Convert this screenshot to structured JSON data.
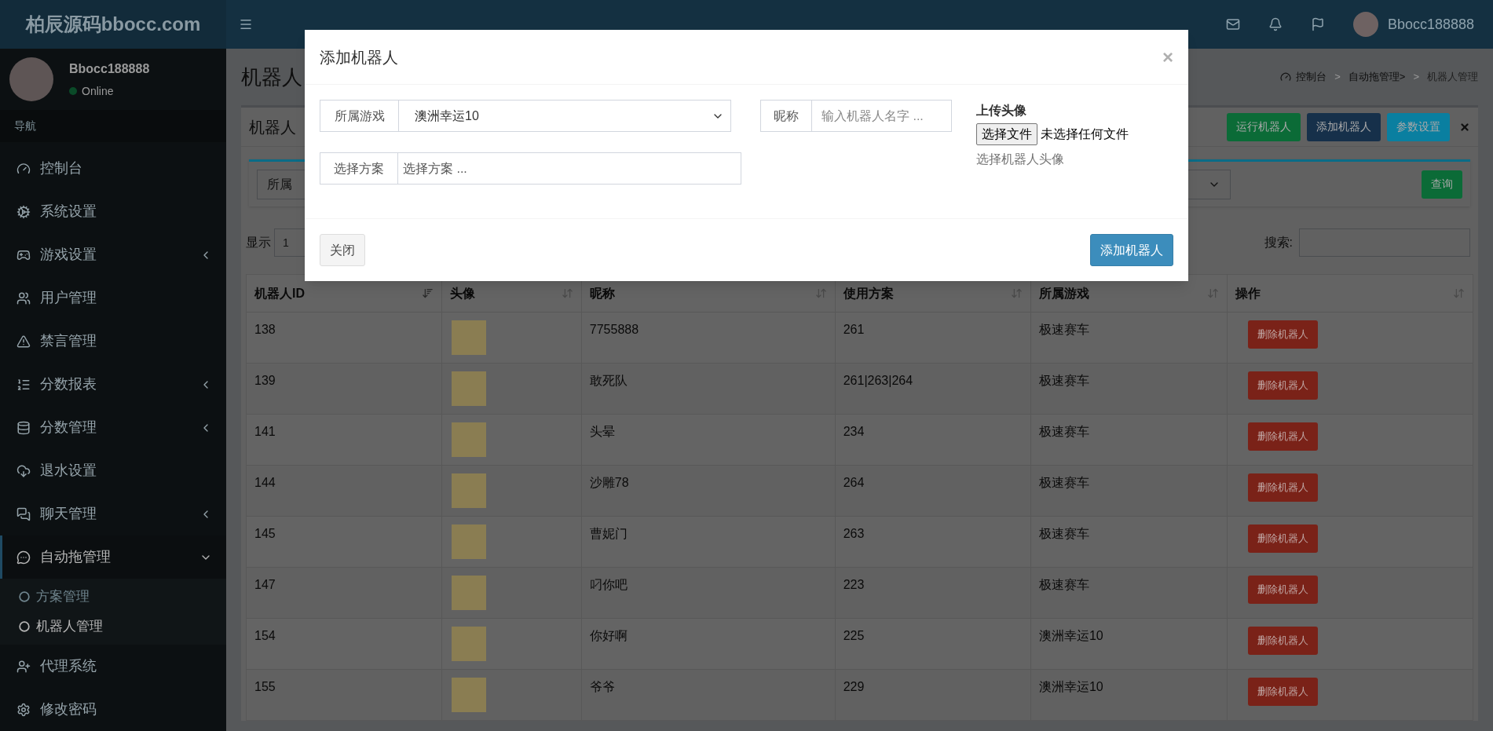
{
  "header": {
    "logo": "柏辰源码bbocc.com",
    "user_name": "Bbocc188888"
  },
  "sidebar": {
    "user": {
      "name": "Bbocc188888",
      "status": "Online"
    },
    "nav_header": "导航",
    "items": [
      {
        "label": "控制台",
        "selected": false
      },
      {
        "label": "系统设置",
        "selected": false
      },
      {
        "label": "游戏设置",
        "selected": false,
        "expanded": false
      },
      {
        "label": "用户管理",
        "selected": false
      },
      {
        "label": "禁言管理",
        "selected": false
      },
      {
        "label": "分数报表",
        "selected": false,
        "expanded": false
      },
      {
        "label": "分数管理",
        "selected": false,
        "expanded": false
      },
      {
        "label": "退水设置",
        "selected": false
      },
      {
        "label": "聊天管理",
        "selected": false,
        "expanded": false
      },
      {
        "label": "自动拖管理",
        "selected": true,
        "expanded": true,
        "children": [
          {
            "label": "方案管理",
            "selected": false
          },
          {
            "label": "机器人管理",
            "selected": true
          }
        ]
      },
      {
        "label": "代理系统",
        "selected": false
      },
      {
        "label": "修改密码",
        "selected": false
      }
    ]
  },
  "page": {
    "title": "机器人",
    "breadcrumb": [
      {
        "label": "控制台"
      },
      {
        "separator": ">",
        "label": "自动拖管理>"
      },
      {
        "separator": ">",
        "label": "机器人管理"
      }
    ],
    "box": {
      "title": "机器人",
      "buttons": [
        {
          "label": "运行机器人",
          "color": "#0b6b37"
        },
        {
          "label": "添加机器人",
          "color": "#16304a"
        },
        {
          "label": "参数设置",
          "color": "#0a7fa0"
        }
      ],
      "filter": {
        "select_value": "所属",
        "query_button": "查询"
      },
      "show_label": "显示",
      "page_size": "1",
      "search_label": "搜索:",
      "table": {
        "columns": [
          {
            "label": "机器人ID",
            "sorted": true
          },
          {
            "label": "头像",
            "sorted": false
          },
          {
            "label": "昵称",
            "sorted": false
          },
          {
            "label": "使用方案",
            "sorted": false
          },
          {
            "label": "所属游戏",
            "sorted": false
          },
          {
            "label": "操作",
            "sorted": false
          }
        ],
        "rows": [
          {
            "id": "138",
            "nickname": "7755888",
            "plan": "261",
            "game": "极速赛车",
            "action": "删除机器人"
          },
          {
            "id": "139",
            "nickname": "敢死队",
            "plan": "261|263|264",
            "game": "极速赛车",
            "action": "删除机器人"
          },
          {
            "id": "141",
            "nickname": "头晕",
            "plan": "234",
            "game": "极速赛车",
            "action": "删除机器人"
          },
          {
            "id": "144",
            "nickname": "沙雕78",
            "plan": "264",
            "game": "极速赛车",
            "action": "删除机器人"
          },
          {
            "id": "145",
            "nickname": "曹妮门",
            "plan": "263",
            "game": "极速赛车",
            "action": "删除机器人"
          },
          {
            "id": "147",
            "nickname": "叼你吧",
            "plan": "223",
            "game": "极速赛车",
            "action": "删除机器人"
          },
          {
            "id": "154",
            "nickname": "你好啊",
            "plan": "225",
            "game": "澳洲幸运10",
            "action": "删除机器人"
          },
          {
            "id": "155",
            "nickname": "爷爷",
            "plan": "229",
            "game": "澳洲幸运10",
            "action": "删除机器人"
          }
        ]
      }
    }
  },
  "modal": {
    "title": "添加机器人",
    "close": "×",
    "game": {
      "label": "所属游戏",
      "value": "澳洲幸运10"
    },
    "nickname": {
      "label": "昵称",
      "placeholder": "输入机器人名字 ..."
    },
    "plan": {
      "label": "选择方案",
      "placeholder": "选择方案 ..."
    },
    "upload": {
      "label": "上传头像",
      "button": "选择文件",
      "status": "未选择任何文件",
      "help": "选择机器人头像"
    },
    "close_button": "关闭",
    "submit_button": "添加机器人"
  }
}
